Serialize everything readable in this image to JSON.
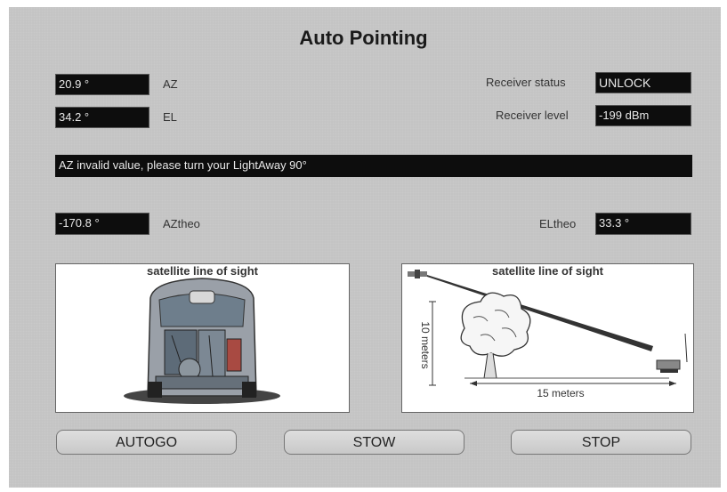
{
  "title": "Auto Pointing",
  "az": {
    "value": "20.9 °",
    "label": "AZ"
  },
  "el": {
    "value": "34.2 °",
    "label": "EL"
  },
  "receiver_status": {
    "label": "Receiver status",
    "value": "UNLOCK"
  },
  "receiver_level": {
    "label": "Receiver level",
    "value": "-199 dBm"
  },
  "message": "AZ invalid value, please turn your LightAway 90°",
  "aztheo": {
    "value": "-170.8 °",
    "label": "AZtheo"
  },
  "eltheo": {
    "label": "ELtheo",
    "value": "33.3 °"
  },
  "left_image": {
    "caption": "satellite line of sight"
  },
  "right_image": {
    "caption": "satellite line of sight",
    "height_label": "10 meters",
    "distance_label": "15 meters"
  },
  "buttons": {
    "autogo": "AUTOGO",
    "stow": "STOW",
    "stop": "STOP"
  }
}
